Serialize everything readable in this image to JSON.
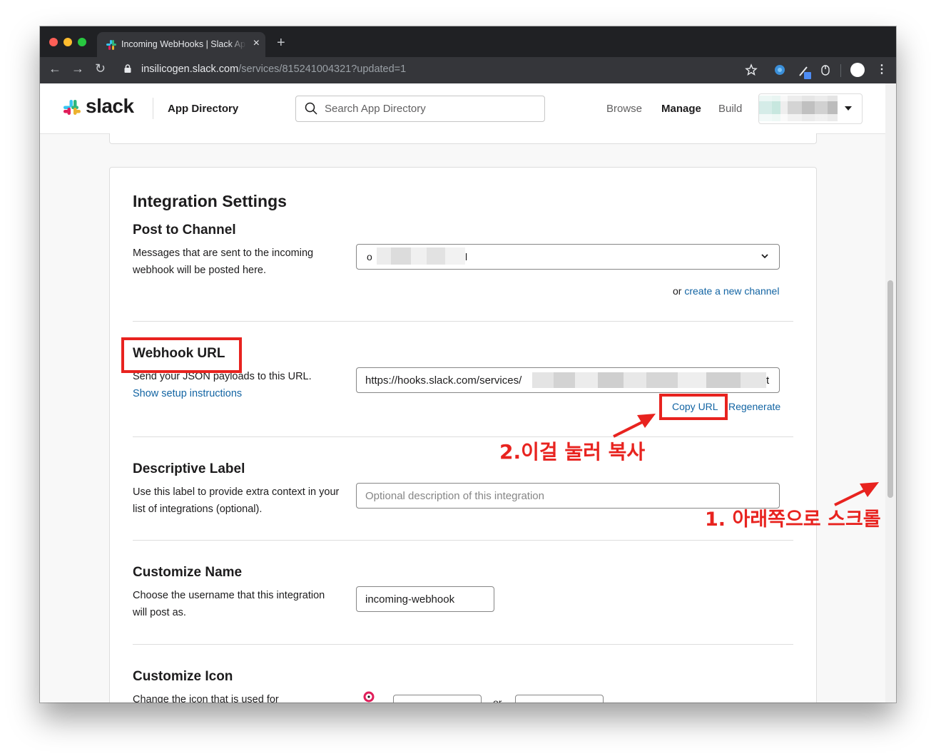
{
  "browser": {
    "tab_title": "Incoming WebHooks | Slack App Directory",
    "url_host": "insilicogen.slack.com",
    "url_path": "/services/815241004321?updated=1"
  },
  "header": {
    "brand": "slack",
    "app_directory": "App Directory",
    "search_placeholder": "Search App Directory",
    "nav": [
      "Browse",
      "Manage",
      "Build"
    ]
  },
  "integration": {
    "heading": "Integration Settings",
    "post_to_channel": {
      "title": "Post to Channel",
      "description": "Messages that are sent to the incoming webhook will be posted here.",
      "select_value_prefix": "o",
      "select_value_suffix": "l",
      "or_text": "or",
      "create_link": "create a new channel"
    },
    "webhook_url": {
      "title": "Webhook URL",
      "description": "Send your JSON payloads to this URL.",
      "setup_link": "Show setup instructions",
      "url_value": "https://hooks.slack.com/services/",
      "url_tail": "t",
      "copy_label": "Copy URL",
      "regenerate_label": "Regenerate"
    },
    "descriptive_label": {
      "title": "Descriptive Label",
      "description": "Use this label to provide extra context in your list of integrations (optional).",
      "placeholder": "Optional description of this integration"
    },
    "customize_name": {
      "title": "Customize Name",
      "description": "Choose the username that this integration will post as.",
      "value": "incoming-webhook"
    },
    "customize_icon": {
      "title": "Customize Icon",
      "description": "Change the icon that is used for",
      "or_text": "or"
    }
  },
  "annotations": {
    "step2": "2.이걸 눌러 복사",
    "step1": "1. 아래쪽으로 스크롤"
  },
  "colors": {
    "annotation_red": "#e8231f",
    "link_blue": "#1264a3",
    "chrome_dark": "#202124",
    "chrome_toolbar": "#35363a"
  }
}
